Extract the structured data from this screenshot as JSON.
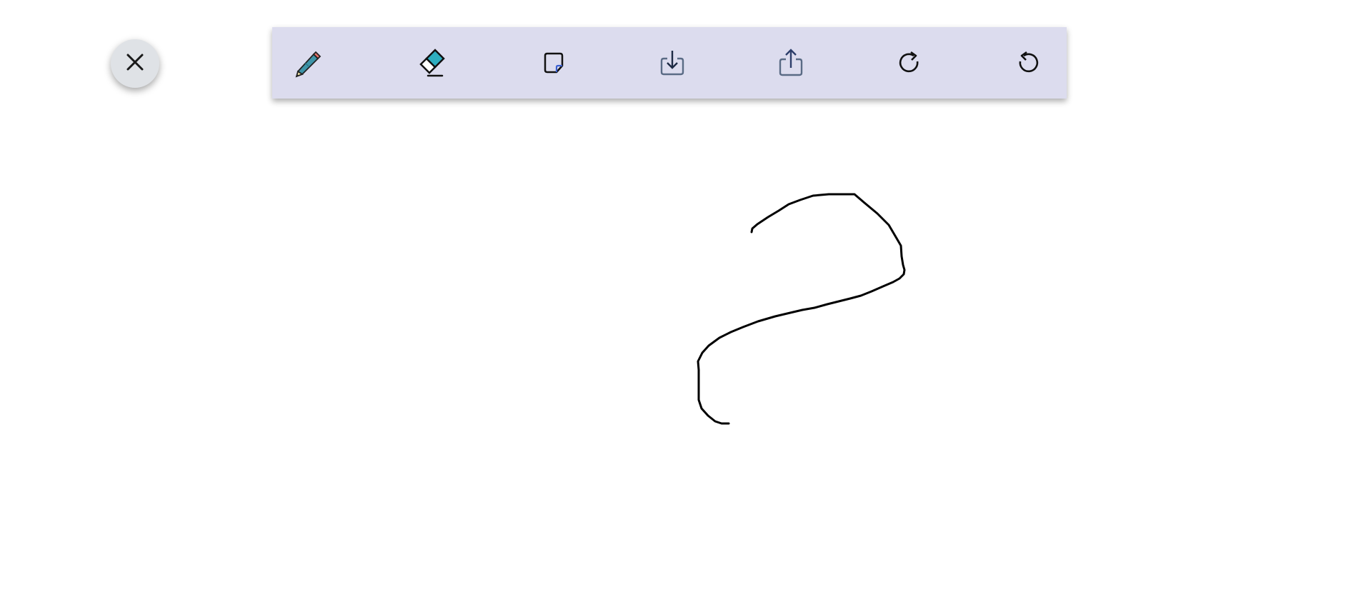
{
  "close_button": {
    "icon": "close-icon"
  },
  "toolbar": {
    "background": "#dcdcee",
    "tools": [
      {
        "name": "pencil",
        "icon": "pencil-icon"
      },
      {
        "name": "eraser",
        "icon": "eraser-icon"
      },
      {
        "name": "note",
        "icon": "sticky-note-icon"
      },
      {
        "name": "download",
        "icon": "download-icon"
      },
      {
        "name": "share",
        "icon": "share-icon"
      },
      {
        "name": "redo",
        "icon": "redo-icon"
      },
      {
        "name": "undo",
        "icon": "undo-icon"
      }
    ]
  },
  "canvas": {
    "stroke_color": "#000000"
  }
}
